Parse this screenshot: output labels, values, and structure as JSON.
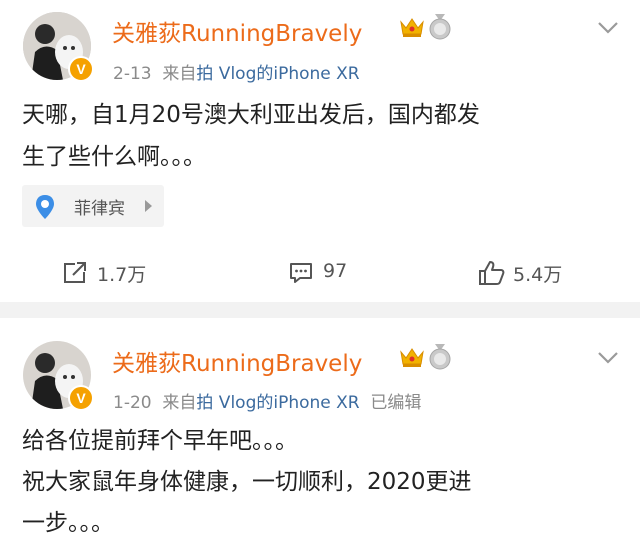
{
  "posts": [
    {
      "username": "关雅荻RunningBravely",
      "date": "2-13",
      "source_prefix": "来自",
      "source": "拍 Vlog的iPhone XR",
      "edited": "",
      "content_lines": [
        "天哪，自1月20号澳大利亚出发后，国内都发",
        "生了些什么啊。。。"
      ],
      "location": "菲律宾",
      "actions": {
        "repost": "1.7万",
        "comment": "97",
        "like": "5.4万"
      }
    },
    {
      "username": "关雅荻RunningBravely",
      "date": "1-20",
      "source_prefix": "来自",
      "source": "拍 Vlog的iPhone XR",
      "edited": "已编辑",
      "content_lines": [
        "给各位提前拜个早年吧。。。",
        "祝大家鼠年身体健康，一切顺利，2020更进",
        "一步。。。"
      ]
    }
  ],
  "badges": {
    "verified": "V"
  },
  "icons": [
    "crown-icon",
    "medal-icon",
    "chevron-down-icon",
    "location-pin-icon",
    "repost-icon",
    "comment-icon",
    "like-icon"
  ],
  "colors": {
    "username": "#ec6b1a",
    "source": "#3b6a9e",
    "verified_badge": "#f5a100",
    "location_pin": "#3c8ee6"
  }
}
